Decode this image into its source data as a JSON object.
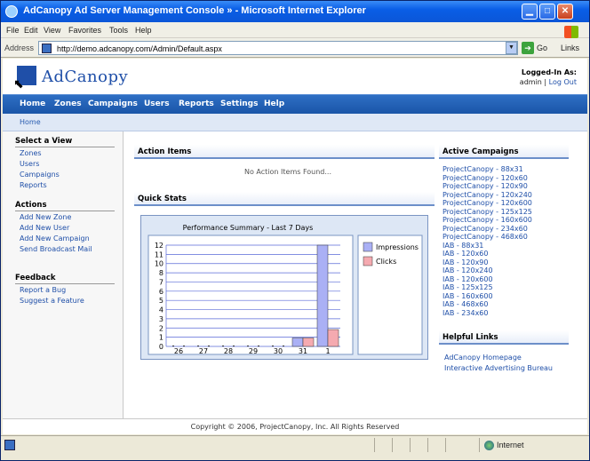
{
  "browser": {
    "title": "AdCanopy Ad Server Management Console » - Microsoft Internet Explorer",
    "menu": [
      "File",
      "Edit",
      "View",
      "Favorites",
      "Tools",
      "Help"
    ],
    "address_label": "Address",
    "url": "http://demo.adcanopy.com/Admin/Default.aspx",
    "go_label": "Go",
    "links_label": "Links",
    "status_zone": "Internet"
  },
  "header": {
    "logo_text": "AdCanopy",
    "login_title": "Logged-In As:",
    "user": "admin",
    "logout": "Log Out"
  },
  "nav": [
    "Home",
    "Zones",
    "Campaigns",
    "Users",
    "Reports",
    "Settings",
    "Help"
  ],
  "breadcrumb": "Home",
  "sidebar": {
    "select_view": {
      "title": "Select a View",
      "items": [
        "Zones",
        "Users",
        "Campaigns",
        "Reports"
      ]
    },
    "actions": {
      "title": "Actions",
      "items": [
        "Add New Zone",
        "Add New User",
        "Add New Campaign",
        "Send Broadcast Mail"
      ]
    },
    "feedback": {
      "title": "Feedback",
      "items": [
        "Report a Bug",
        "Suggest a Feature"
      ]
    }
  },
  "main": {
    "action_items_title": "Action Items",
    "no_items": "No Action Items Found...",
    "quick_stats_title": "Quick Stats"
  },
  "chart_data": {
    "type": "bar",
    "title": "Performance Summary - Last 7 Days",
    "categories": [
      "26",
      "27",
      "28",
      "29",
      "30",
      "31",
      "1"
    ],
    "series": [
      {
        "name": "Impressions",
        "values": [
          0,
          0,
          0,
          0,
          0,
          1,
          12
        ]
      },
      {
        "name": "Clicks",
        "values": [
          0,
          0,
          0,
          0,
          0,
          1,
          2
        ]
      }
    ],
    "y_ticks": [
      "0",
      "1",
      "2",
      "3",
      "4",
      "5",
      "6",
      "7",
      "8",
      "10",
      "11",
      "12"
    ],
    "ylim": [
      0,
      12
    ],
    "grid": true,
    "legend": "right",
    "colors": {
      "Impressions": "#aab0f5",
      "Clicks": "#f5aab0"
    }
  },
  "right": {
    "active_title": "Active Campaigns",
    "campaigns": [
      "ProjectCanopy - 88x31",
      "ProjectCanopy - 120x60",
      "ProjectCanopy - 120x90",
      "ProjectCanopy - 120x240",
      "ProjectCanopy - 120x600",
      "ProjectCanopy - 125x125",
      "ProjectCanopy - 160x600",
      "ProjectCanopy - 234x60",
      "ProjectCanopy - 468x60",
      "IAB - 88x31",
      "IAB - 120x60",
      "IAB - 120x90",
      "IAB - 120x240",
      "IAB - 120x600",
      "IAB - 125x125",
      "IAB - 160x600",
      "IAB - 468x60",
      "IAB - 234x60"
    ],
    "helpful_title": "Helpful Links",
    "helpful_links": [
      "AdCanopy Homepage",
      "Interactive Advertising Bureau"
    ]
  },
  "footer": "Copyright © 2006, ProjectCanopy, Inc. All Rights Reserved"
}
